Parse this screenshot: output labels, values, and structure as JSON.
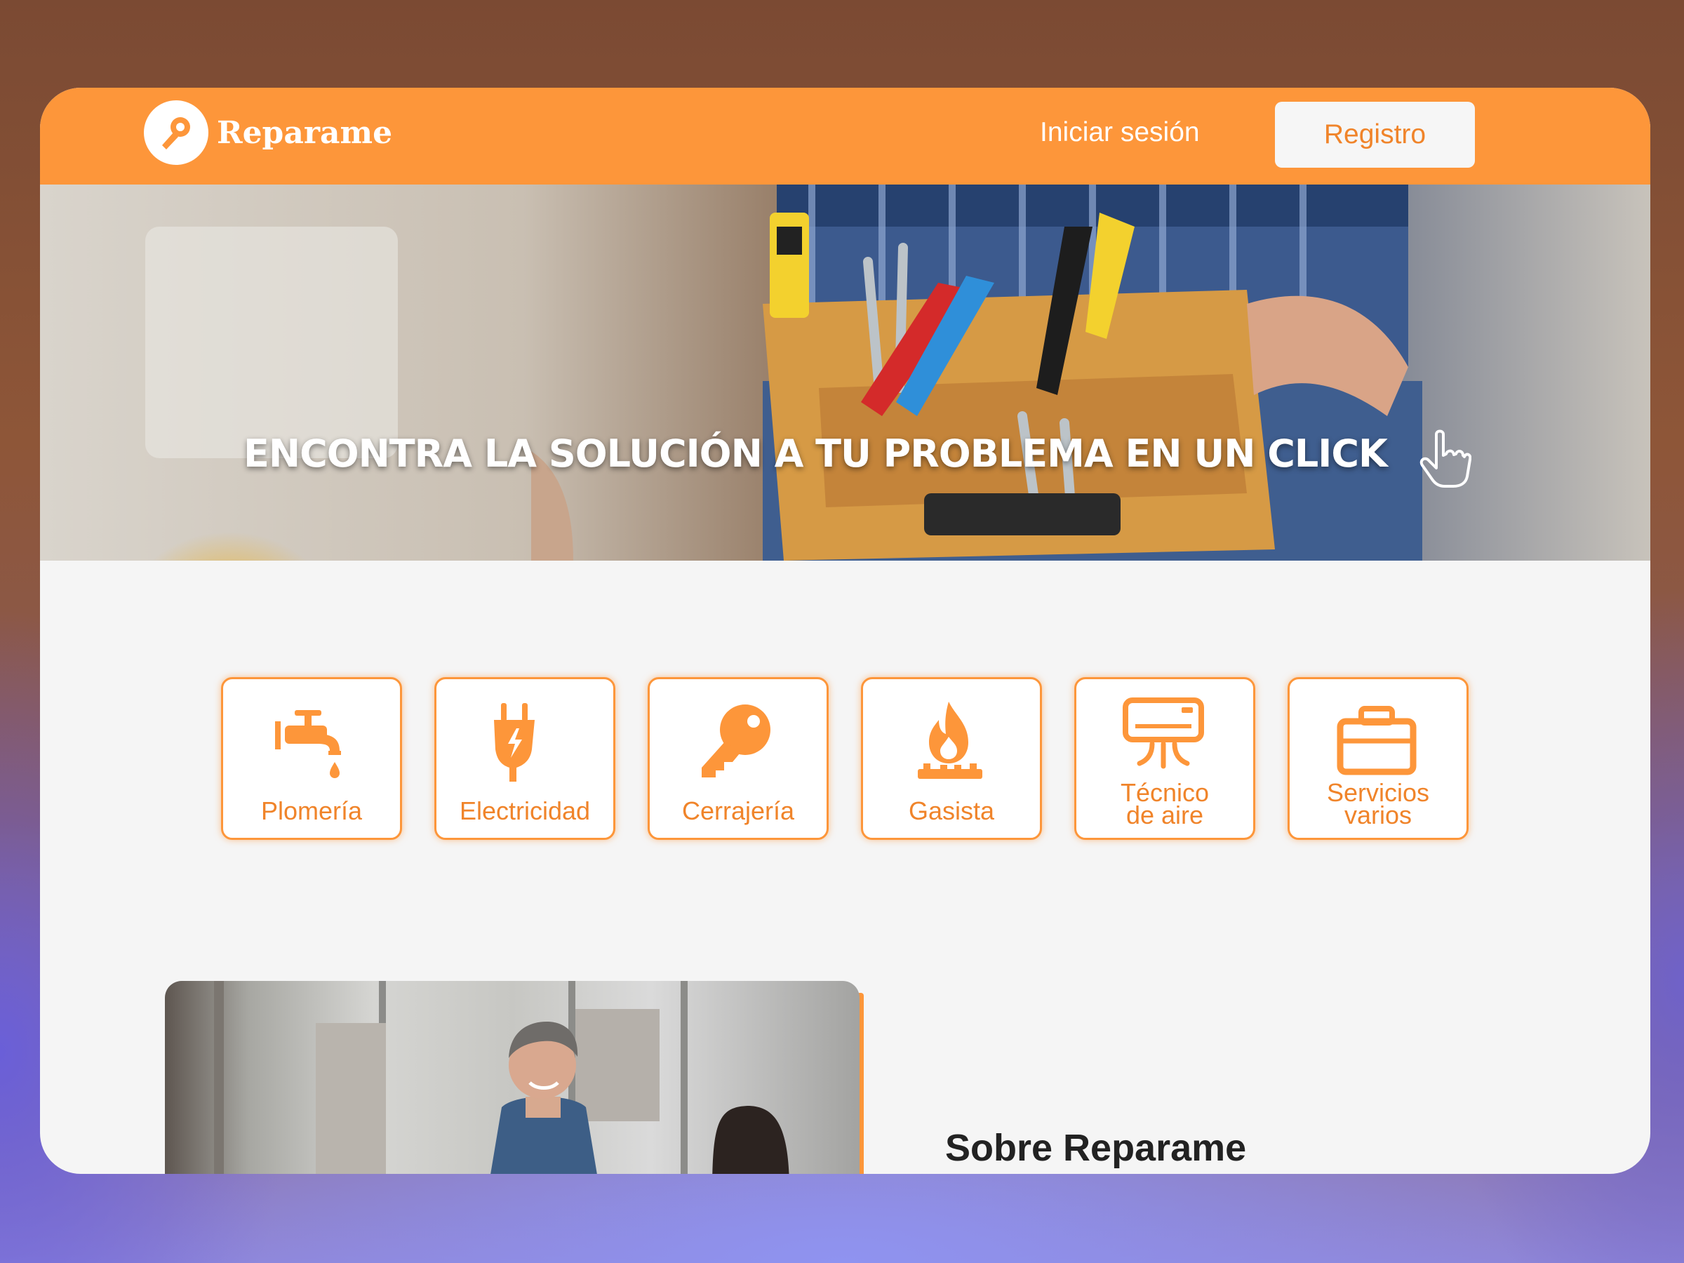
{
  "colors": {
    "brand": "#fd963a",
    "brand_text": "#f0842a",
    "page_bg": "#f5f5f5"
  },
  "header": {
    "logo_text": "Reparame",
    "logo_icon": "wrench-icon",
    "login_label": "Iniciar sesión",
    "register_label": "Registro"
  },
  "hero": {
    "title": "ENCONTRA LA SOLUCIÓN A TU PROBLEMA EN UN CLICK",
    "icon": "pointer-hand-icon"
  },
  "categories": [
    {
      "label_lines": [
        "Plomería"
      ],
      "icon": "faucet-icon"
    },
    {
      "label_lines": [
        "Electricidad"
      ],
      "icon": "plug-icon"
    },
    {
      "label_lines": [
        "Cerrajería"
      ],
      "icon": "key-icon"
    },
    {
      "label_lines": [
        "Gasista"
      ],
      "icon": "flame-icon"
    },
    {
      "label_lines": [
        "Técnico",
        "de aire"
      ],
      "icon": "air-conditioner-icon"
    },
    {
      "label_lines": [
        "Servicios",
        "varios"
      ],
      "icon": "briefcase-icon"
    }
  ],
  "about": {
    "title": "Sobre Reparame"
  }
}
